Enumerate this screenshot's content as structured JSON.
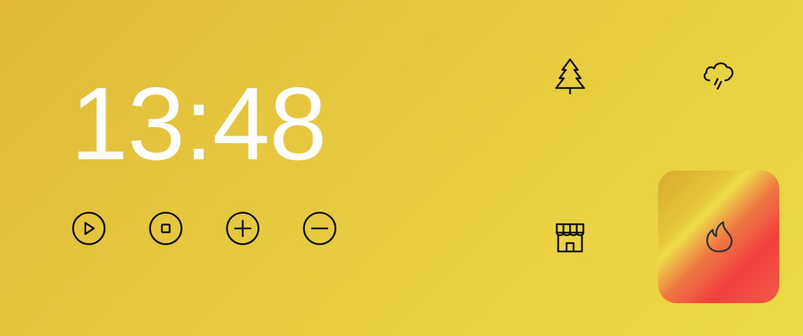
{
  "clock": {
    "time": "13:48"
  },
  "controls": [
    {
      "name": "play",
      "icon": "play-circle-icon"
    },
    {
      "name": "stop",
      "icon": "stop-circle-icon"
    },
    {
      "name": "add",
      "icon": "plus-circle-icon"
    },
    {
      "name": "remove",
      "icon": "minus-circle-icon"
    }
  ],
  "scenes": [
    {
      "name": "forest",
      "icon": "tree-icon",
      "active": false
    },
    {
      "name": "rain",
      "icon": "cloud-rain-icon",
      "active": false
    },
    {
      "name": "shop",
      "icon": "storefront-icon",
      "active": false
    },
    {
      "name": "fire",
      "icon": "flame-icon",
      "active": true
    }
  ],
  "colors": {
    "background": "#e6c83e",
    "clock_text": "#ffffff",
    "icon_stroke": "#111111",
    "active_tile_red": "#f2403c",
    "active_tile_yellow": "#eddc47"
  }
}
